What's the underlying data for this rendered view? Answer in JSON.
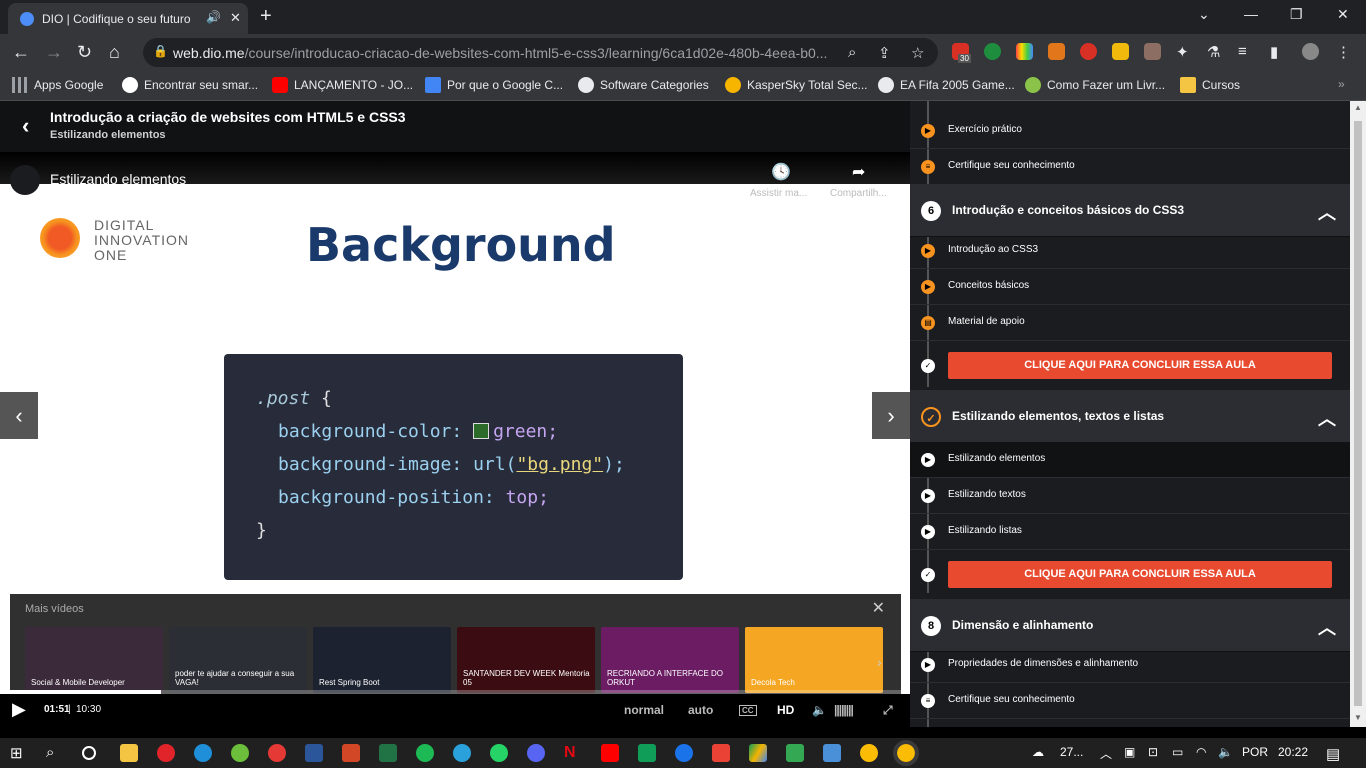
{
  "browser": {
    "tab_title": "DIO | Codifique o seu futuro",
    "url_domain": "web.dio.me",
    "url_path": "/course/introducao-criacao-de-websites-com-html5-e-css3/learning/6ca1d02e-480b-4eea-b0...",
    "ext_badge": "30"
  },
  "bookmarks": [
    {
      "label": "Apps Google",
      "color": "#9aa0a6"
    },
    {
      "label": "Encontrar seu smar...",
      "color": "#ffffff"
    },
    {
      "label": "LANÇAMENTO - JO...",
      "color": "#ff0000"
    },
    {
      "label": "Por que o Google C...",
      "color": "#4285f4"
    },
    {
      "label": "Software Categories",
      "color": "#e8eaed"
    },
    {
      "label": "KasperSky Total Sec...",
      "color": "#f7b500"
    },
    {
      "label": "EA Fifa 2005 Game...",
      "color": "#e8eaed"
    },
    {
      "label": "Como Fazer um Livr...",
      "color": "#8bc34a"
    },
    {
      "label": "Cursos",
      "color": "#f4c542"
    }
  ],
  "course": {
    "title": "Introdução a criação de websites com HTML5 e CSS3",
    "subtitle": "Estilizando elementos"
  },
  "video": {
    "title": "Estilizando elementos",
    "watch_later": "Assistir ma...",
    "share": "Compartilh...",
    "slide_logo_text": [
      "DIGITAL",
      "INNOVATION",
      "ONE"
    ],
    "slide_title": "Background",
    "code": {
      "selector": ".post",
      "open": "{",
      "close": "}",
      "p1": "background-color:",
      "v1": "green;",
      "p2": "background-image:",
      "v2a": "url(",
      "v2str": "\"bg.png\"",
      "v2b": ");",
      "p3": "background-position:",
      "v3": "top;"
    },
    "more_label": "Mais vídeos",
    "current_time": "01:51",
    "separator": "|",
    "duration": "10:30",
    "progress": 0.177,
    "quality_normal": "normal",
    "quality_auto": "auto",
    "cc": "CC",
    "hd": "HD",
    "thumbs": [
      {
        "text": "Social & Mobile Developer",
        "color": "#3a2a3a"
      },
      {
        "text": "poder te ajudar a conseguir a sua VAGA!",
        "color": "#2b2e35"
      },
      {
        "text": "Rest Spring Boot",
        "color": "#1c2230"
      },
      {
        "text": "SANTANDER DEV WEEK  Mentoria 05",
        "color": "#3b0d12"
      },
      {
        "text": "RECRIANDO A INTERFACE DO ORKUT",
        "color": "#6b1c63"
      },
      {
        "text": "Decola Tech",
        "color": "#f5a623"
      }
    ]
  },
  "sidebar": {
    "top_items": [
      {
        "label": "Exercício prático"
      },
      {
        "label": "Certifique seu conhecimento"
      }
    ],
    "sections": [
      {
        "number": "6",
        "title": "Introdução e conceitos básicos do CSS3",
        "items": [
          "Introdução ao CSS3",
          "Conceitos básicos",
          "Material de apoio"
        ]
      },
      {
        "number": "",
        "title": "Estilizando elementos, textos e listas",
        "items": [
          "Estilizando elementos",
          "Estilizando textos",
          "Estilizando listas"
        ]
      },
      {
        "number": "8",
        "title": "Dimensão e alinhamento",
        "items": [
          "Propriedades de dimensões e alinhamento",
          "Certifique seu conhecimento"
        ]
      }
    ],
    "cta": "CLIQUE AQUI PARA CONCLUIR ESSA AULA"
  },
  "taskbar": {
    "weather": "27...",
    "lang": "POR",
    "time": "20:22"
  }
}
